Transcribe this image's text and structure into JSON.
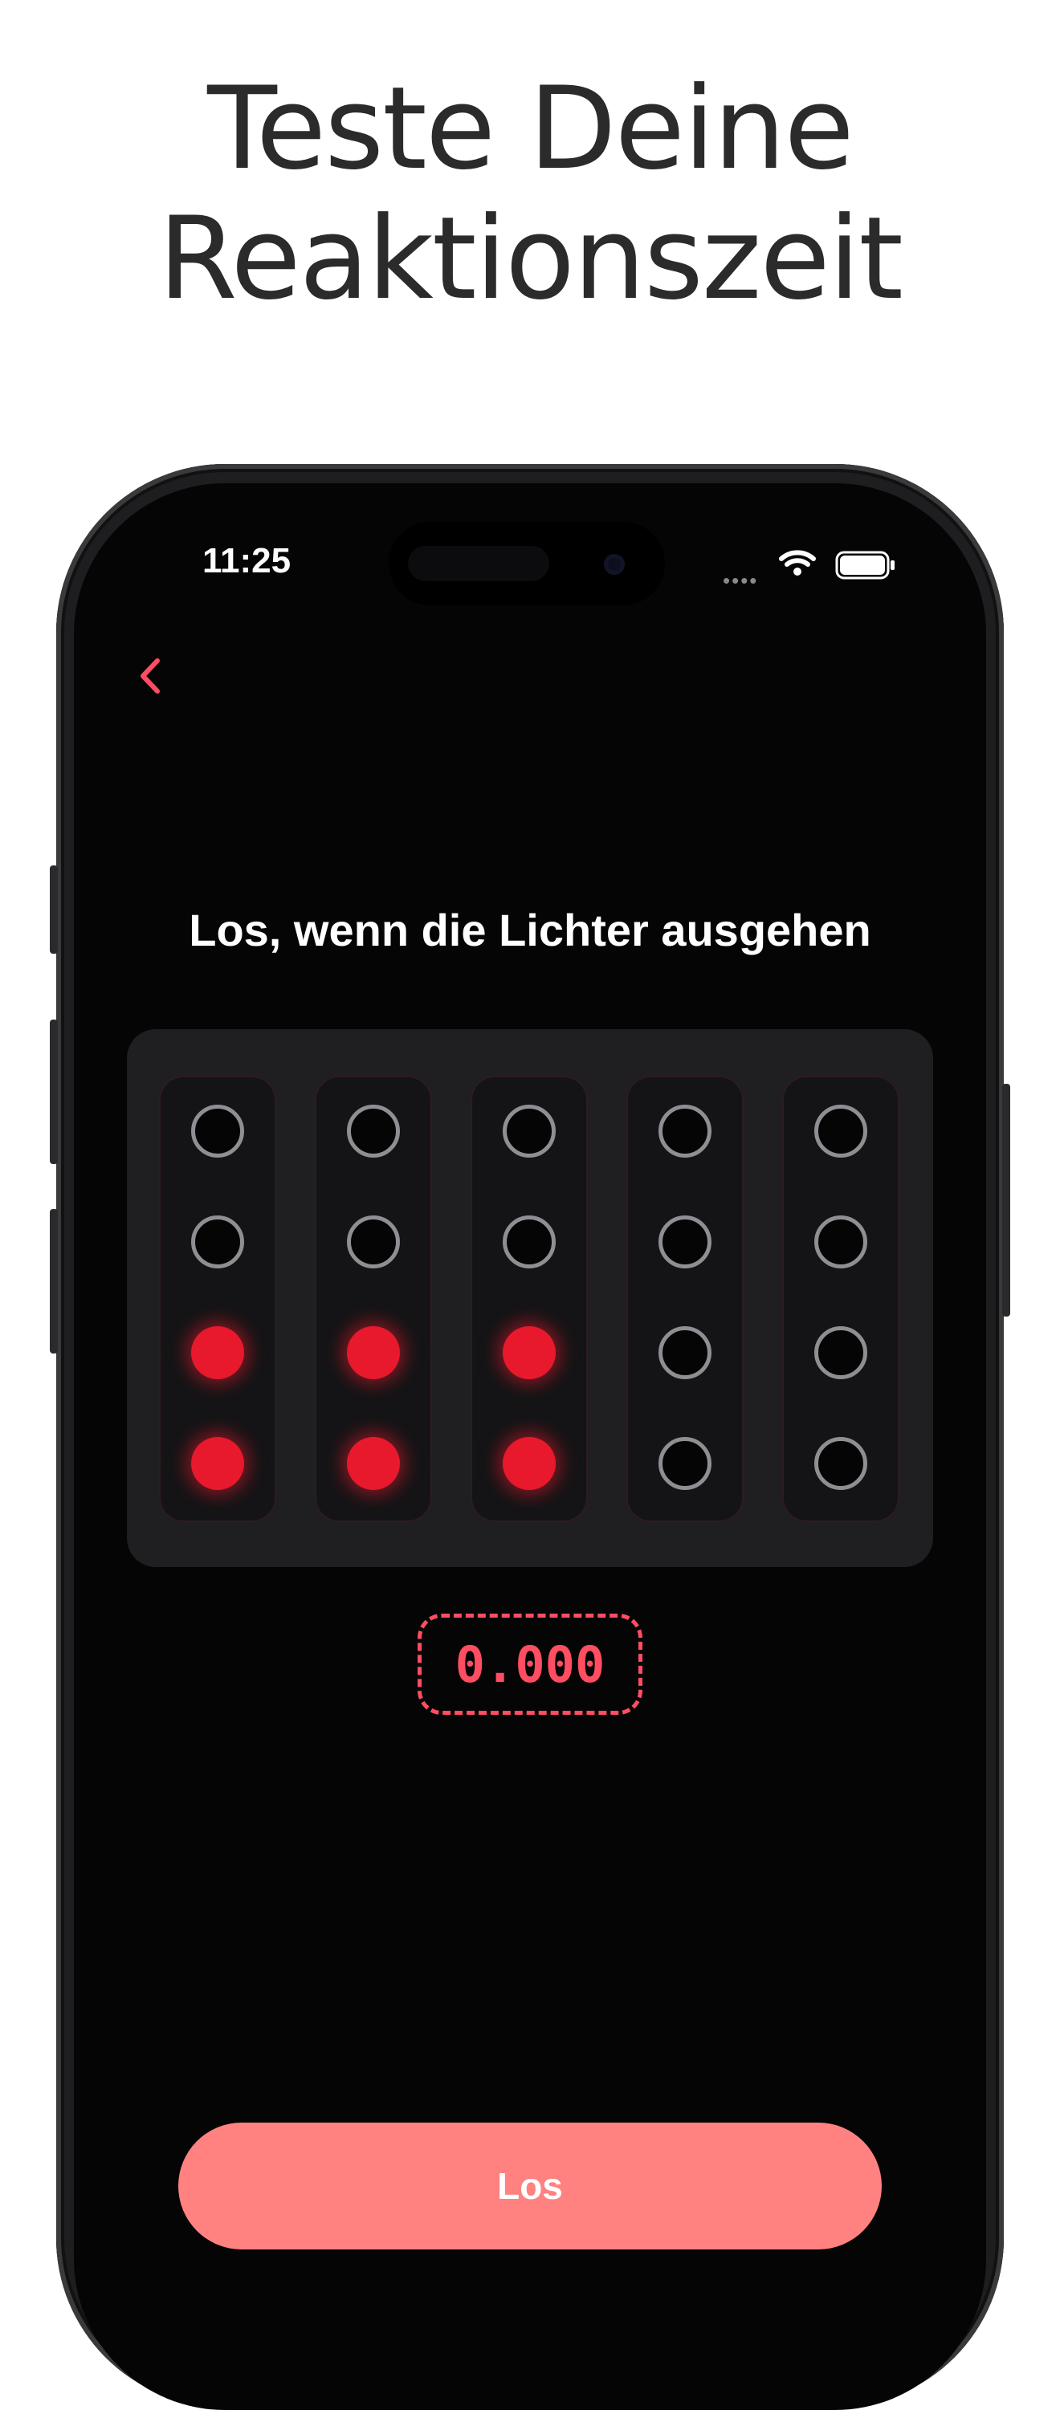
{
  "headline": {
    "line1": "Teste Deine",
    "line2": "Reaktionszeit"
  },
  "status_bar": {
    "time": "11:25",
    "signal_icon": "cellular-signal-icon",
    "wifi_icon": "wifi-icon",
    "battery_icon": "battery-icon"
  },
  "nav": {
    "back_icon": "chevron-left-icon"
  },
  "instruction": "Los, wenn die Lichter ausgehen",
  "lights": {
    "columns": 5,
    "rows": 4,
    "lit_columns": 3,
    "lit_rows_from_bottom": 2,
    "on_color": "#e8192c",
    "off_ring_color": "#8e8e93"
  },
  "timer": {
    "value": "0.000"
  },
  "go_button": {
    "label": "Los"
  },
  "colors": {
    "accent": "#ff4d62",
    "button": "#ff8280",
    "panel": "#1f1f21",
    "screen_background": "#050505"
  }
}
